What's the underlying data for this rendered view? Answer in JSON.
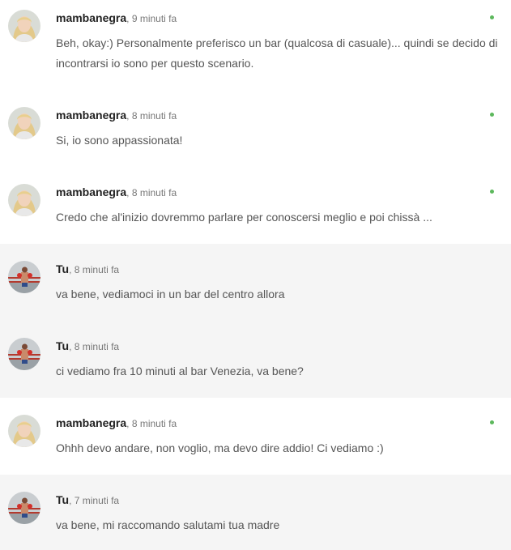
{
  "colors": {
    "online_dot": "#5cb85c",
    "my_message_background": "#f5f5f5",
    "their_message_background": "#ffffff"
  },
  "messages": [
    {
      "author": "mambanegra",
      "time": ", 9 minuti fa",
      "text": "Beh, okay:) Personalmente preferisco un bar (qualcosa di casuale)... quindi se decido di incontrarsi io sono per questo scenario.",
      "mine": false,
      "online": true,
      "avatar_icon": "woman-avatar-icon"
    },
    {
      "author": "mambanegra",
      "time": ", 8 minuti fa",
      "text": "Si, io sono appassionata!",
      "mine": false,
      "online": true,
      "avatar_icon": "woman-avatar-icon"
    },
    {
      "author": "mambanegra",
      "time": ", 8 minuti fa",
      "text": "Credo che al'inizio dovremmo parlare per conoscersi meglio e poi chissà ...",
      "mine": false,
      "online": true,
      "avatar_icon": "woman-avatar-icon"
    },
    {
      "author": "Tu",
      "time": ", 8 minuti fa",
      "text": "va bene, vediamoci in un bar del centro allora",
      "mine": true,
      "online": false,
      "avatar_icon": "boxer-avatar-icon"
    },
    {
      "author": "Tu",
      "time": ", 8 minuti fa",
      "text": "ci vediamo fra 10 minuti al bar Venezia, va bene?",
      "mine": true,
      "online": false,
      "avatar_icon": "boxer-avatar-icon"
    },
    {
      "author": "mambanegra",
      "time": ", 8 minuti fa",
      "text": "Ohhh devo andare, non voglio, ma devo dire addio! Ci vediamo :)",
      "mine": false,
      "online": true,
      "avatar_icon": "woman-avatar-icon"
    },
    {
      "author": "Tu",
      "time": ", 7 minuti fa",
      "text": "va bene, mi raccomando salutami tua madre",
      "mine": true,
      "online": false,
      "avatar_icon": "boxer-avatar-icon"
    }
  ]
}
